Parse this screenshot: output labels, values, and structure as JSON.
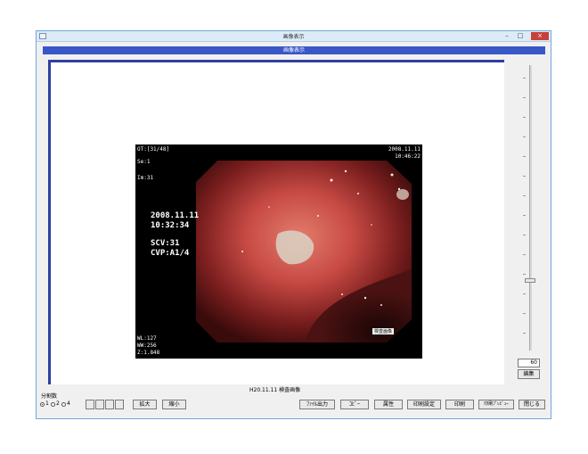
{
  "window": {
    "title": "画像表示"
  },
  "panel": {
    "title": "画像表示"
  },
  "image_overlay": {
    "top_left": [
      "OT:[31/48]",
      "Se:1",
      "Im:31"
    ],
    "top_right": [
      "2008.11.11",
      "10:46:22"
    ],
    "date": "2008.11.11",
    "time": "10:32:34",
    "scv": "SCV:31",
    "cvp": "CVP:A1/4",
    "bottom_left": [
      "WL:127",
      "WW:256",
      "Z:1.848"
    ],
    "tag": "検査画像"
  },
  "caption": "H20.11.11  検査画像",
  "slider": {
    "value": "60",
    "edit_label": "編集"
  },
  "split": {
    "label": "分割数",
    "options": [
      "1",
      "2",
      "4"
    ],
    "selected": "1"
  },
  "toolbar": {
    "zoom_in": "拡大",
    "zoom_out": "縮小",
    "file_output": "ﾌｧｲﾙ出力",
    "copy": "ｺﾋﾟｰ",
    "attributes": "属性",
    "print_settings": "印刷設定",
    "print": "印刷",
    "print_preview": "印刷ﾌﾟﾚﾋﾞｭｰ",
    "close": "閉じる"
  }
}
